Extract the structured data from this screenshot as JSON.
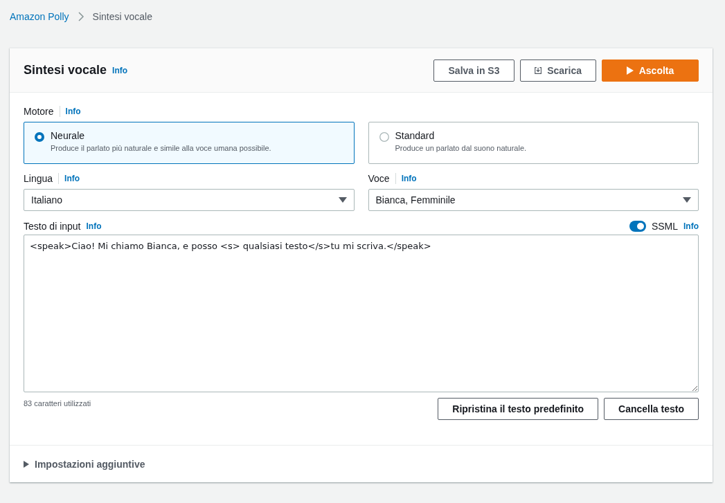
{
  "breadcrumb": [
    {
      "label": "Amazon Polly",
      "kind": "link"
    },
    {
      "label": "Sintesi vocale",
      "kind": "current"
    }
  ],
  "header": {
    "title": "Sintesi vocale",
    "info": "Info",
    "buttons": [
      {
        "label": "Salva in S3",
        "kind": "normal"
      },
      {
        "label": "Scarica",
        "kind": "download"
      },
      {
        "label": "Ascolta",
        "kind": "primary"
      }
    ]
  },
  "engine": {
    "label": "Motore",
    "info": "Info",
    "options": [
      {
        "title": "Neurale",
        "description": "Produce il parlato più naturale e simile alla voce umana possibile.",
        "selected": true
      },
      {
        "title": "Standard",
        "description": "Produce un parlato dal suono naturale.",
        "selected": false
      }
    ]
  },
  "selects": [
    {
      "label": "Lingua",
      "info": "Info",
      "value": "Italiano"
    },
    {
      "label": "Voce",
      "info": "Info",
      "value": "Bianca, Femminile"
    }
  ],
  "input": {
    "label": "Testo di input",
    "info": "Info",
    "ssml": {
      "label": "SSML",
      "info": "Info",
      "on": true
    },
    "value": "<speak>Ciao! Mi chiamo Bianca, e posso <s> qualsiasi testo</s>tu mi scriva.</speak>",
    "count": "83 caratteri utilizzati",
    "buttons": [
      "Ripristina il testo predefinito",
      "Cancella testo"
    ]
  },
  "additional": {
    "label": "Impostazioni aggiuntive",
    "expanded": false
  }
}
